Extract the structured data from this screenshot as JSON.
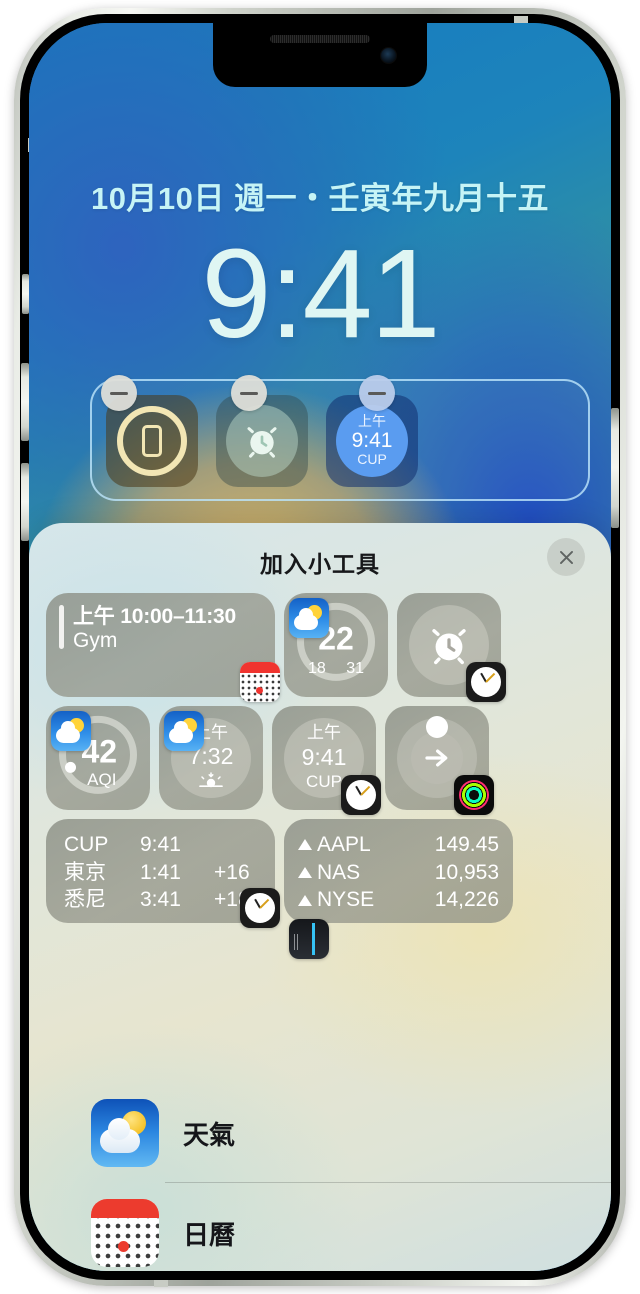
{
  "lockscreen": {
    "date": "10月10日 週一・壬寅年九月十五",
    "time": "9:41",
    "widgets": [
      {
        "name": "find-my",
        "icon": "phone-in-ring-icon",
        "remove_label": "−"
      },
      {
        "name": "alarm",
        "icon": "alarm-clock-icon",
        "remove_label": "−"
      },
      {
        "name": "world-clock",
        "ampm": "上午",
        "time": "9:41",
        "city": "CUP",
        "remove_label": "−"
      }
    ]
  },
  "sheet": {
    "title": "加入小工具",
    "close_label": "×"
  },
  "gallery": {
    "calendar_event": {
      "time": "上午 10:00–11:30",
      "title": "Gym",
      "badge": "calendar-app-icon"
    },
    "temperature": {
      "current": "22",
      "low": "18",
      "high": "31",
      "badge": "weather-app-icon"
    },
    "alarm": {
      "icon": "alarm-clock-icon",
      "badge": "clock-app-icon"
    },
    "air_quality": {
      "value": "42",
      "label": "AQI",
      "badge": "weather-app-icon"
    },
    "sunset": {
      "ampm": "上午",
      "time": "7:32",
      "icon": "sunset-icon",
      "badge": "weather-app-icon"
    },
    "world_clock": {
      "ampm": "上午",
      "time": "9:41",
      "city": "CUP",
      "badge": "clock-app-icon"
    },
    "fitness": {
      "icon": "arrow-right-icon",
      "badge": "fitness-app-icon"
    },
    "world_clock_list": {
      "rows": [
        {
          "city": "CUP",
          "time": "9:41",
          "offset": ""
        },
        {
          "city": "東京",
          "time": "1:41",
          "offset": "+16"
        },
        {
          "city": "悉尼",
          "time": "3:41",
          "offset": "+18"
        }
      ],
      "badge": "clock-app-icon"
    },
    "stocks": {
      "rows": [
        {
          "trend": "▲",
          "symbol": "AAPL",
          "value": "149.45"
        },
        {
          "trend": "▲",
          "symbol": "NAS",
          "value": "10,953"
        },
        {
          "trend": "▲",
          "symbol": "NYSE",
          "value": "14,226"
        }
      ],
      "badge": "stocks-app-icon"
    }
  },
  "app_list": [
    {
      "name": "天氣",
      "icon": "weather-app-icon"
    },
    {
      "name": "日曆",
      "icon": "calendar-app-icon"
    }
  ],
  "colors": {
    "accent_blue": "#5a9cf0",
    "calendar_red": "#ec3b2e",
    "weather_blue": "#2b86e0",
    "time_text": "#dff6f3",
    "date_text": "#c6f4f6"
  }
}
